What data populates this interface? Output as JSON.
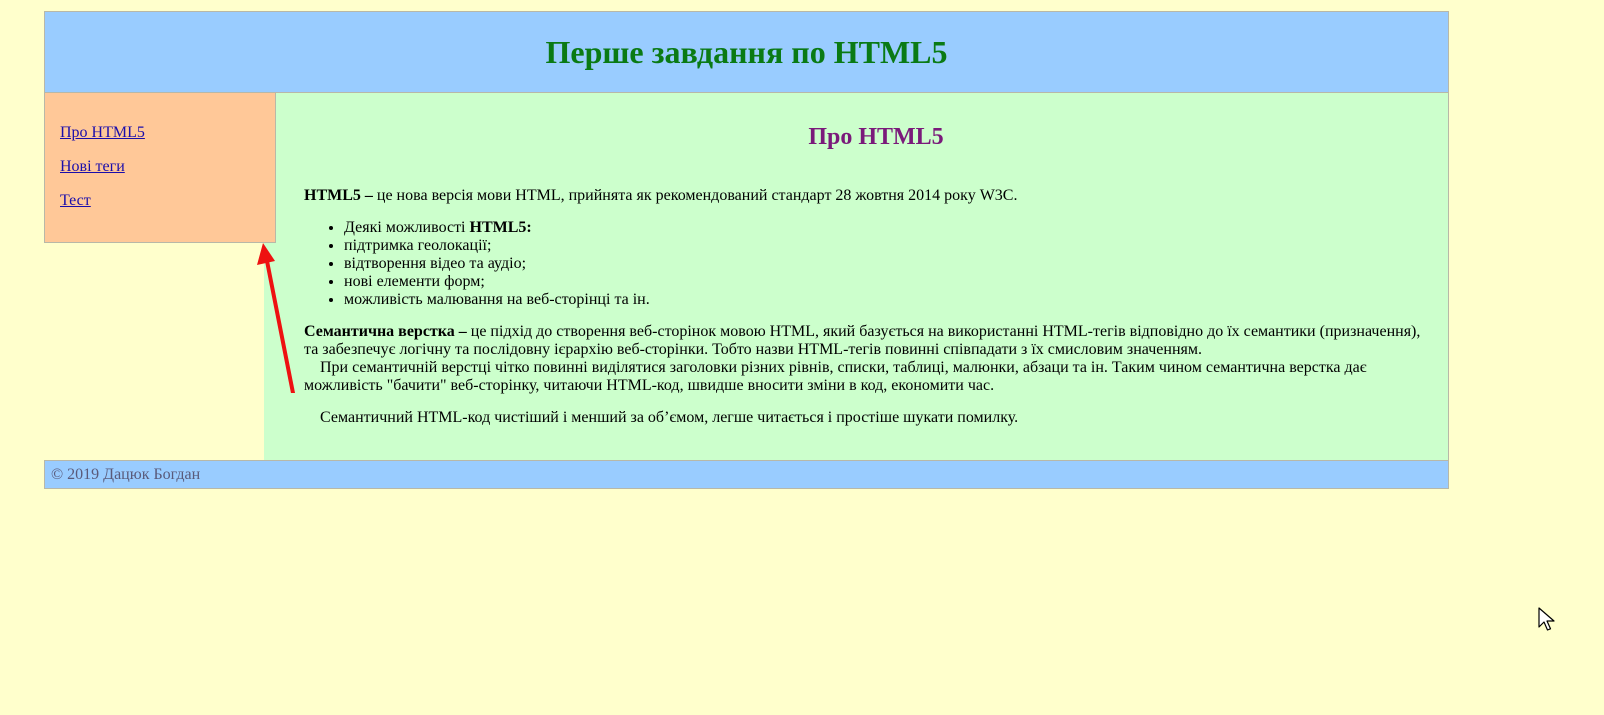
{
  "header": {
    "title": "Перше завдання по HTML5"
  },
  "nav": {
    "items": [
      {
        "label": "Про HTML5"
      },
      {
        "label": "Нові теги"
      },
      {
        "label": "Тест"
      }
    ]
  },
  "main": {
    "heading": "Про HTML5",
    "intro_bold": "HTML5 –",
    "intro_text": " це нова версія мови HTML, прийнята як рекомендований стандарт 28 жовтня 2014 року W3C.",
    "list": [
      {
        "prefix": "Деякі можливості ",
        "bold": "HTML5:"
      },
      {
        "text": "підтримка геолокації;"
      },
      {
        "text": "відтворення відео та аудіо;"
      },
      {
        "text": "нові елементи форм;"
      },
      {
        "text": "можливість малювання на веб-сторінці та ін."
      }
    ],
    "semantic_bold": "Семантична верстка –",
    "semantic_text": " це підхід до створення веб-сторінок мовою HTML, який базується на використанні HTML-тегів відповідно до їх семантики (призначення), та забезпечує логічну та послідовну ієрархію веб-сторінки. Тобто назви HTML-тегів повинні співпадати з їх смисловим значенням.",
    "semantic_para2": "При семантичній верстці чітко повинні виділятися заголовки різних рівнів, списки, таблиці, малюнки, абзаци та ін. Таким чином семантична верстка дає можливість \"бачити\" веб-сторінку, читаючи HTML-код, швидше вносити зміни в код, економити час.",
    "semantic_para3": "Семантичний HTML-код чистіший і менший за об’ємом, легше читається і простіше шукати помилку."
  },
  "footer": {
    "text": "© 2019 Дацюк Богдан"
  },
  "colors": {
    "page_bg": "#ffffcc",
    "header_bg": "#99ccff",
    "title_color": "#0a7a14",
    "nav_bg": "#ffc898",
    "main_bg": "#ccffcc",
    "heading_color": "#7a1a7a",
    "arrow_color": "#ee1111"
  },
  "icons": {
    "arrow": "red-arrow-annotation",
    "cursor": "mouse-pointer-icon"
  }
}
